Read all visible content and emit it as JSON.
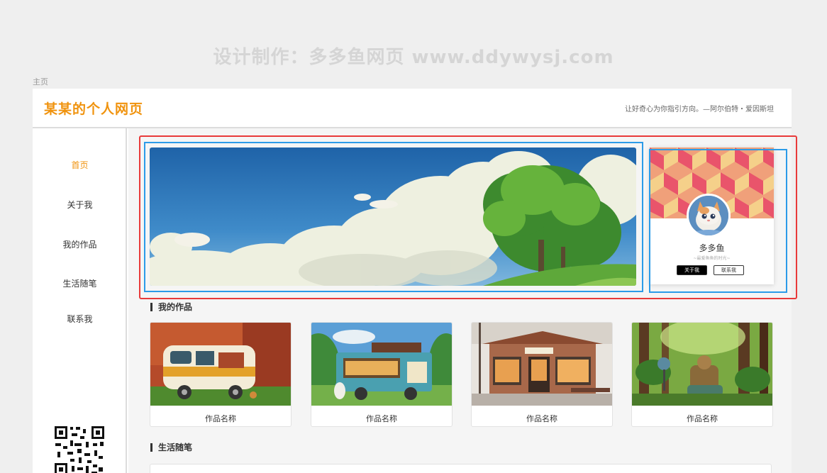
{
  "watermark": "设计制作：多多鱼网页  www.ddywysj.com",
  "page_label": "主页",
  "header": {
    "title": "某某的个人网页",
    "motto": "让好奇心为你指引方向。—阿尔伯特・爱因斯坦"
  },
  "sidebar": {
    "items": [
      {
        "label": "首页",
        "active": true
      },
      {
        "label": "关于我",
        "active": false
      },
      {
        "label": "我的作品",
        "active": false
      },
      {
        "label": "生活随笔",
        "active": false
      },
      {
        "label": "联系我",
        "active": false
      }
    ]
  },
  "profile": {
    "name": "多多鱼",
    "subtitle": "~最爱鱼鱼的时光~",
    "about_button": "关于我",
    "contact_button": "联系我"
  },
  "works": {
    "title": "我的作品",
    "items": [
      {
        "name": "作品名称"
      },
      {
        "name": "作品名称"
      },
      {
        "name": "作品名称"
      },
      {
        "name": "作品名称"
      }
    ]
  },
  "essays": {
    "title": "生活随笔"
  },
  "colors": {
    "accent": "#f0930e",
    "highlight_red": "#e83a3a",
    "highlight_blue": "#2c9be8"
  }
}
